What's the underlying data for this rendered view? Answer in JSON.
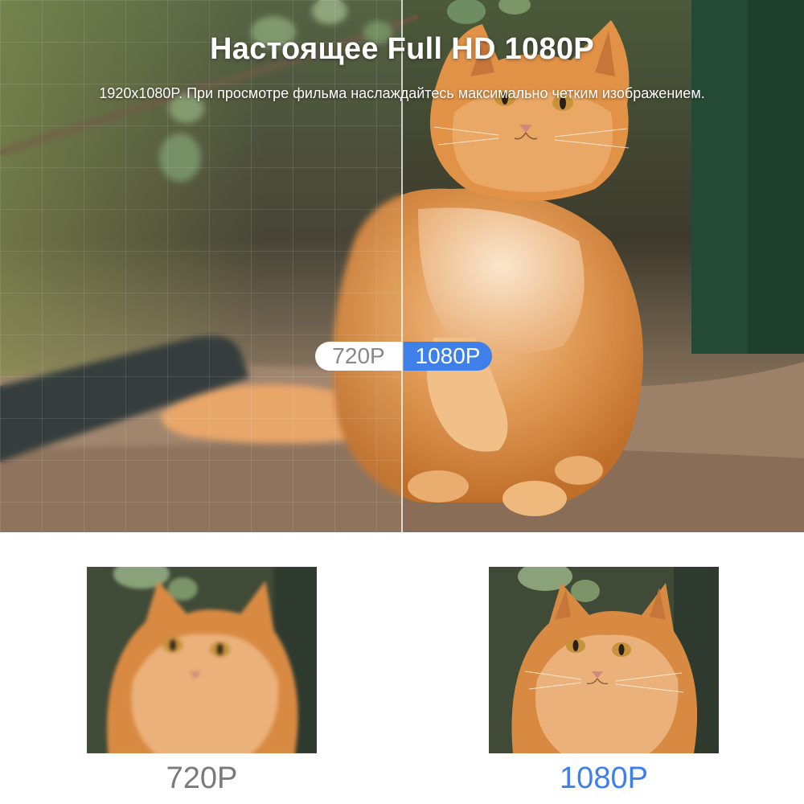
{
  "hero": {
    "title": "Настоящее Full HD 1080P",
    "subtitle": "1920x1080P. При просмотре фильма наслаждайтесь максимально четким изображением."
  },
  "comparison_toggle": {
    "left_label": "720P",
    "right_label": "1080P"
  },
  "thumbnails": {
    "left_caption": "720P",
    "right_caption": "1080P"
  },
  "colors": {
    "accent_blue": "#3f7fe8",
    "caption_gray": "#7a7a7a",
    "cat_orange": "#d9813a"
  },
  "photo_subject": "orange long-haired cat sitting on dirt path"
}
